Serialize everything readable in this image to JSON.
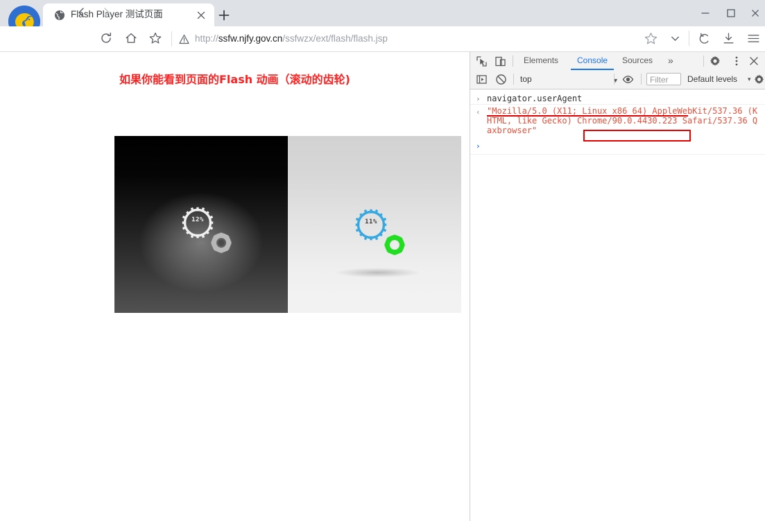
{
  "window": {
    "controls": [
      {
        "name": "minimize",
        "glyph": "minimize-icon"
      },
      {
        "name": "maximize",
        "glyph": "maximize-icon"
      },
      {
        "name": "close",
        "glyph": "close-icon"
      }
    ]
  },
  "browser": {
    "logo_icon": "qax-browser-logo-icon",
    "tab": {
      "favicon": "globe-icon",
      "title": "Flash Player 测试页面",
      "close_label": "✕"
    },
    "newtab_label": "+",
    "nav": {
      "back_icon": "arrow-left-icon",
      "forward_icon": "arrow-right-icon",
      "reload_icon": "reload-icon",
      "home_icon": "home-icon",
      "bookmark_icon": "star-outline-icon"
    },
    "address": {
      "security_icon": "warning-triangle-icon",
      "scheme": "http://",
      "host": "ssfw.njfy.gov.cn",
      "path": "/ssfwzx/ext/flash/flash.jsp",
      "full_url": "http://ssfw.njfy.gov.cn/ssfwzx/ext/flash/flash.jsp"
    },
    "toolbar_right": [
      {
        "name": "star-icon"
      },
      {
        "name": "chevron-down-icon"
      },
      {
        "name": "history-undo-icon"
      },
      {
        "name": "download-icon"
      },
      {
        "name": "hamburger-menu-icon"
      }
    ]
  },
  "page": {
    "heading": "如果你能看到页面的Flash 动画（滚动的齿轮)",
    "heading_color": "#ff2222",
    "flash": {
      "left": {
        "background": "dark-gradient",
        "main_gear_color": "#f2f2f2",
        "small_gear_color": "#b4b4b4",
        "percent": "12%"
      },
      "right": {
        "background": "light-gradient",
        "main_gear_color": "#35a8e0",
        "small_gear_color": "#22dd22",
        "percent": "11%"
      }
    }
  },
  "devtools": {
    "toolbar_icons": [
      {
        "name": "inspect-element-icon"
      },
      {
        "name": "device-toolbar-icon"
      }
    ],
    "tabs": [
      {
        "label": "Elements",
        "active": false
      },
      {
        "label": "Console",
        "active": true
      },
      {
        "label": "Sources",
        "active": false
      },
      {
        "label": "»",
        "active": false
      }
    ],
    "actions": [
      {
        "name": "settings-gear-icon"
      },
      {
        "name": "more-options-kebab-icon"
      },
      {
        "name": "close-devtools-icon"
      }
    ],
    "filterbar": {
      "execution_context_icon": "execution-context-icon",
      "clear_console_icon": "clear-console-icon",
      "context": "top",
      "eye_icon": "live-expression-eye-icon",
      "filter_placeholder": "Filter",
      "filter_value": "",
      "levels": "Default levels",
      "settings_icon": "console-settings-gear-icon"
    },
    "console": {
      "entries": [
        {
          "kind": "input",
          "gutter": "›",
          "text": "navigator.userAgent"
        },
        {
          "kind": "result",
          "gutter": "‹",
          "text": "\"Mozilla/5.0 (X11; Linux x86_64) AppleWebKit/537.36 (KHTML, like Gecko) Chrome/90.0.4430.223 Safari/537.36 Qaxbrowser\""
        }
      ],
      "prompt_gutter": "›",
      "annotation": {
        "highlight_text": "Chrome/90.0.4430.223",
        "color": "#e60000"
      }
    }
  }
}
